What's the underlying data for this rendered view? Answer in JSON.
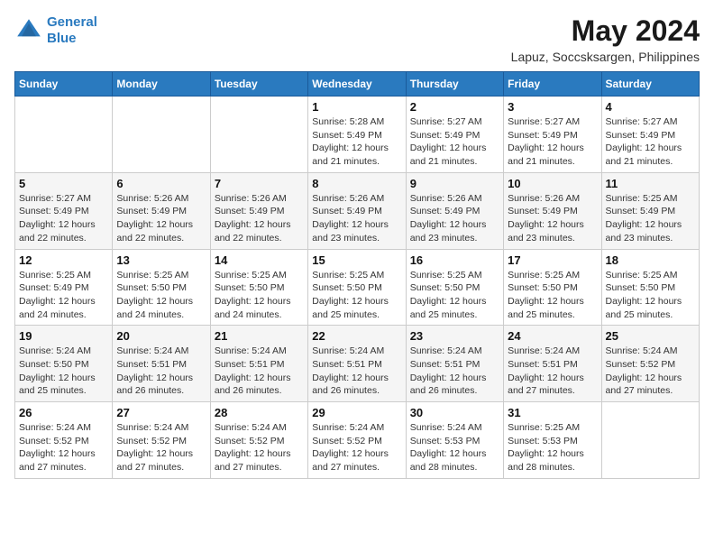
{
  "header": {
    "logo_line1": "General",
    "logo_line2": "Blue",
    "title": "May 2024",
    "subtitle": "Lapuz, Soccsksargen, Philippines"
  },
  "calendar": {
    "days_of_week": [
      "Sunday",
      "Monday",
      "Tuesday",
      "Wednesday",
      "Thursday",
      "Friday",
      "Saturday"
    ],
    "weeks": [
      [
        {
          "day": "",
          "info": ""
        },
        {
          "day": "",
          "info": ""
        },
        {
          "day": "",
          "info": ""
        },
        {
          "day": "1",
          "info": "Sunrise: 5:28 AM\nSunset: 5:49 PM\nDaylight: 12 hours\nand 21 minutes."
        },
        {
          "day": "2",
          "info": "Sunrise: 5:27 AM\nSunset: 5:49 PM\nDaylight: 12 hours\nand 21 minutes."
        },
        {
          "day": "3",
          "info": "Sunrise: 5:27 AM\nSunset: 5:49 PM\nDaylight: 12 hours\nand 21 minutes."
        },
        {
          "day": "4",
          "info": "Sunrise: 5:27 AM\nSunset: 5:49 PM\nDaylight: 12 hours\nand 21 minutes."
        }
      ],
      [
        {
          "day": "5",
          "info": "Sunrise: 5:27 AM\nSunset: 5:49 PM\nDaylight: 12 hours\nand 22 minutes."
        },
        {
          "day": "6",
          "info": "Sunrise: 5:26 AM\nSunset: 5:49 PM\nDaylight: 12 hours\nand 22 minutes."
        },
        {
          "day": "7",
          "info": "Sunrise: 5:26 AM\nSunset: 5:49 PM\nDaylight: 12 hours\nand 22 minutes."
        },
        {
          "day": "8",
          "info": "Sunrise: 5:26 AM\nSunset: 5:49 PM\nDaylight: 12 hours\nand 23 minutes."
        },
        {
          "day": "9",
          "info": "Sunrise: 5:26 AM\nSunset: 5:49 PM\nDaylight: 12 hours\nand 23 minutes."
        },
        {
          "day": "10",
          "info": "Sunrise: 5:26 AM\nSunset: 5:49 PM\nDaylight: 12 hours\nand 23 minutes."
        },
        {
          "day": "11",
          "info": "Sunrise: 5:25 AM\nSunset: 5:49 PM\nDaylight: 12 hours\nand 23 minutes."
        }
      ],
      [
        {
          "day": "12",
          "info": "Sunrise: 5:25 AM\nSunset: 5:49 PM\nDaylight: 12 hours\nand 24 minutes."
        },
        {
          "day": "13",
          "info": "Sunrise: 5:25 AM\nSunset: 5:50 PM\nDaylight: 12 hours\nand 24 minutes."
        },
        {
          "day": "14",
          "info": "Sunrise: 5:25 AM\nSunset: 5:50 PM\nDaylight: 12 hours\nand 24 minutes."
        },
        {
          "day": "15",
          "info": "Sunrise: 5:25 AM\nSunset: 5:50 PM\nDaylight: 12 hours\nand 25 minutes."
        },
        {
          "day": "16",
          "info": "Sunrise: 5:25 AM\nSunset: 5:50 PM\nDaylight: 12 hours\nand 25 minutes."
        },
        {
          "day": "17",
          "info": "Sunrise: 5:25 AM\nSunset: 5:50 PM\nDaylight: 12 hours\nand 25 minutes."
        },
        {
          "day": "18",
          "info": "Sunrise: 5:25 AM\nSunset: 5:50 PM\nDaylight: 12 hours\nand 25 minutes."
        }
      ],
      [
        {
          "day": "19",
          "info": "Sunrise: 5:24 AM\nSunset: 5:50 PM\nDaylight: 12 hours\nand 25 minutes."
        },
        {
          "day": "20",
          "info": "Sunrise: 5:24 AM\nSunset: 5:51 PM\nDaylight: 12 hours\nand 26 minutes."
        },
        {
          "day": "21",
          "info": "Sunrise: 5:24 AM\nSunset: 5:51 PM\nDaylight: 12 hours\nand 26 minutes."
        },
        {
          "day": "22",
          "info": "Sunrise: 5:24 AM\nSunset: 5:51 PM\nDaylight: 12 hours\nand 26 minutes."
        },
        {
          "day": "23",
          "info": "Sunrise: 5:24 AM\nSunset: 5:51 PM\nDaylight: 12 hours\nand 26 minutes."
        },
        {
          "day": "24",
          "info": "Sunrise: 5:24 AM\nSunset: 5:51 PM\nDaylight: 12 hours\nand 27 minutes."
        },
        {
          "day": "25",
          "info": "Sunrise: 5:24 AM\nSunset: 5:52 PM\nDaylight: 12 hours\nand 27 minutes."
        }
      ],
      [
        {
          "day": "26",
          "info": "Sunrise: 5:24 AM\nSunset: 5:52 PM\nDaylight: 12 hours\nand 27 minutes."
        },
        {
          "day": "27",
          "info": "Sunrise: 5:24 AM\nSunset: 5:52 PM\nDaylight: 12 hours\nand 27 minutes."
        },
        {
          "day": "28",
          "info": "Sunrise: 5:24 AM\nSunset: 5:52 PM\nDaylight: 12 hours\nand 27 minutes."
        },
        {
          "day": "29",
          "info": "Sunrise: 5:24 AM\nSunset: 5:52 PM\nDaylight: 12 hours\nand 27 minutes."
        },
        {
          "day": "30",
          "info": "Sunrise: 5:24 AM\nSunset: 5:53 PM\nDaylight: 12 hours\nand 28 minutes."
        },
        {
          "day": "31",
          "info": "Sunrise: 5:25 AM\nSunset: 5:53 PM\nDaylight: 12 hours\nand 28 minutes."
        },
        {
          "day": "",
          "info": ""
        }
      ]
    ]
  }
}
